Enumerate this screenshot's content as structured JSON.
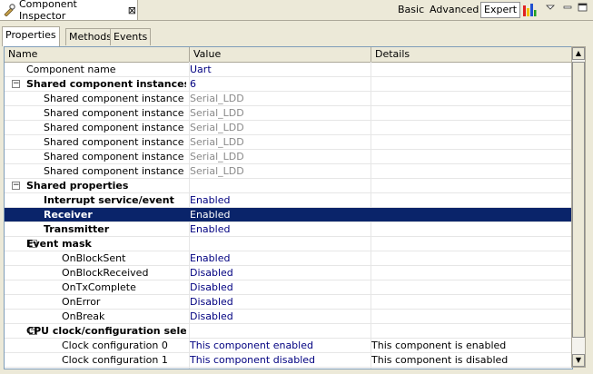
{
  "view": {
    "title": "Component Inspector",
    "close_symbol": "⊠"
  },
  "modes": {
    "basic": "Basic",
    "advanced": "Advanced",
    "expert": "Expert"
  },
  "tabs": [
    "Properties",
    "Methods",
    "Events"
  ],
  "columns": {
    "name": "Name",
    "value": "Value",
    "details": "Details"
  },
  "rows": [
    {
      "name": "Component name",
      "value": "Uart",
      "details": "",
      "level": 1,
      "bold": false,
      "expander": "",
      "value_style": "blue"
    },
    {
      "name": "Shared component instances",
      "value": "6",
      "details": "",
      "level": 0,
      "bold": true,
      "expander": "−",
      "value_style": "blue"
    },
    {
      "name": "Shared component instance 0",
      "value": "Serial_LDD",
      "details": "",
      "level": 2,
      "bold": false,
      "expander": "",
      "value_style": "grey"
    },
    {
      "name": "Shared component instance 1",
      "value": "Serial_LDD",
      "details": "",
      "level": 2,
      "bold": false,
      "expander": "",
      "value_style": "grey"
    },
    {
      "name": "Shared component instance 2",
      "value": "Serial_LDD",
      "details": "",
      "level": 2,
      "bold": false,
      "expander": "",
      "value_style": "grey"
    },
    {
      "name": "Shared component instance 3",
      "value": "Serial_LDD",
      "details": "",
      "level": 2,
      "bold": false,
      "expander": "",
      "value_style": "grey"
    },
    {
      "name": "Shared component instance 4",
      "value": "Serial_LDD",
      "details": "",
      "level": 2,
      "bold": false,
      "expander": "",
      "value_style": "grey"
    },
    {
      "name": "Shared component instance 5",
      "value": "Serial_LDD",
      "details": "",
      "level": 2,
      "bold": false,
      "expander": "",
      "value_style": "grey"
    },
    {
      "name": "Shared properties",
      "value": "",
      "details": "",
      "level": 0,
      "bold": true,
      "expander": "−",
      "value_style": "blue"
    },
    {
      "name": "Interrupt service/event",
      "value": "Enabled",
      "details": "",
      "level": 2,
      "bold": true,
      "expander": "",
      "value_style": "blue"
    },
    {
      "name": "Receiver",
      "value": "Enabled",
      "details": "",
      "level": 2,
      "bold": true,
      "expander": "",
      "value_style": "blue",
      "selected": true
    },
    {
      "name": "Transmitter",
      "value": "Enabled",
      "details": "",
      "level": 2,
      "bold": true,
      "expander": "",
      "value_style": "blue"
    },
    {
      "name": "Event mask",
      "value": "",
      "details": "",
      "level": 1,
      "bold": true,
      "expander": "−",
      "value_style": "blue"
    },
    {
      "name": "OnBlockSent",
      "value": "Enabled",
      "details": "",
      "level": 3,
      "bold": false,
      "expander": "",
      "value_style": "blue"
    },
    {
      "name": "OnBlockReceived",
      "value": "Disabled",
      "details": "",
      "level": 3,
      "bold": false,
      "expander": "",
      "value_style": "blue"
    },
    {
      "name": "OnTxComplete",
      "value": "Disabled",
      "details": "",
      "level": 3,
      "bold": false,
      "expander": "",
      "value_style": "blue"
    },
    {
      "name": "OnError",
      "value": "Disabled",
      "details": "",
      "level": 3,
      "bold": false,
      "expander": "",
      "value_style": "blue"
    },
    {
      "name": "OnBreak",
      "value": "Disabled",
      "details": "",
      "level": 3,
      "bold": false,
      "expander": "",
      "value_style": "blue"
    },
    {
      "name": "CPU clock/configuration sele",
      "value": "",
      "details": "",
      "level": 1,
      "bold": true,
      "expander": "−",
      "value_style": "blue"
    },
    {
      "name": "Clock configuration 0",
      "value": "This component enabled",
      "details": "This component is enabled",
      "level": 3,
      "bold": false,
      "expander": "",
      "value_style": "blue"
    },
    {
      "name": "Clock configuration 1",
      "value": "This component disabled",
      "details": "This component is disabled",
      "level": 3,
      "bold": false,
      "expander": "",
      "value_style": "blue"
    }
  ]
}
